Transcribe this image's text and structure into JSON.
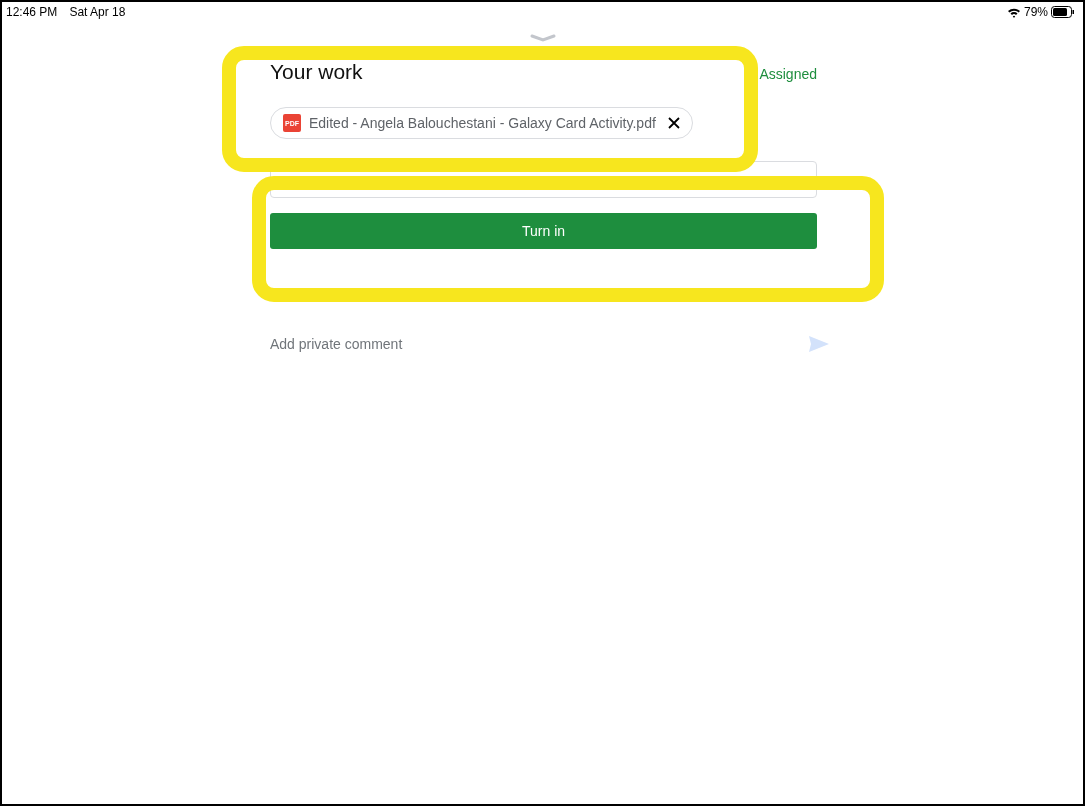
{
  "status_bar": {
    "time": "12:46 PM",
    "date": "Sat Apr 18",
    "battery": "79%"
  },
  "section": {
    "title": "Your work",
    "status": "Assigned"
  },
  "attachment": {
    "name": "Edited - Angela Balouchestani - Galaxy Card Activity.pdf",
    "badge": "PDF"
  },
  "turn_in": {
    "label": "Turn in"
  },
  "comment": {
    "placeholder": "Add private comment"
  }
}
